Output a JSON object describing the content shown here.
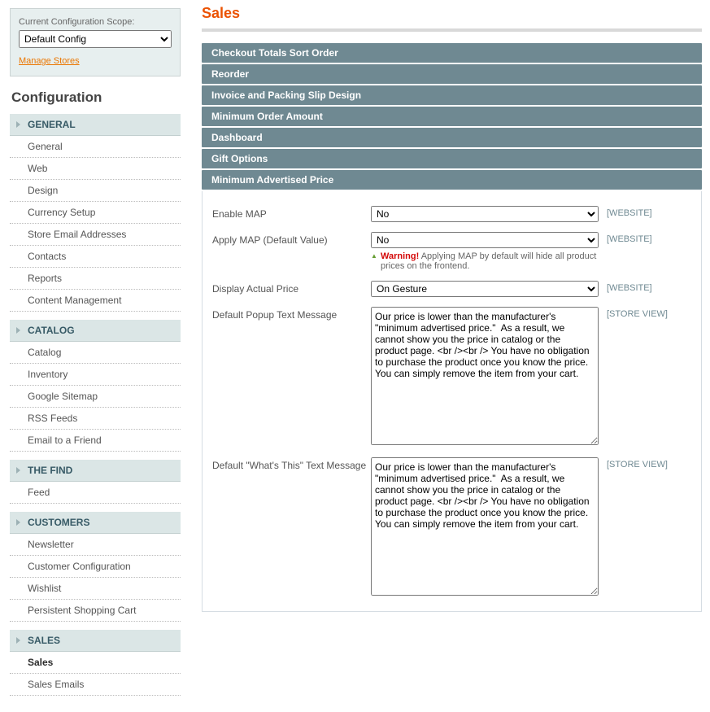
{
  "sidebar": {
    "scope_label": "Current Configuration Scope:",
    "scope_value": "Default Config",
    "manage_stores": "Manage Stores",
    "config_title": "Configuration",
    "groups": [
      {
        "title": "GENERAL",
        "items": [
          "General",
          "Web",
          "Design",
          "Currency Setup",
          "Store Email Addresses",
          "Contacts",
          "Reports",
          "Content Management"
        ]
      },
      {
        "title": "CATALOG",
        "items": [
          "Catalog",
          "Inventory",
          "Google Sitemap",
          "RSS Feeds",
          "Email to a Friend"
        ]
      },
      {
        "title": "THE FIND",
        "items": [
          "Feed"
        ]
      },
      {
        "title": "CUSTOMERS",
        "items": [
          "Newsletter",
          "Customer Configuration",
          "Wishlist",
          "Persistent Shopping Cart"
        ]
      },
      {
        "title": "SALES",
        "items": [
          "Sales",
          "Sales Emails"
        ],
        "active_index": 0
      }
    ]
  },
  "main": {
    "title": "Sales",
    "sections": [
      "Checkout Totals Sort Order",
      "Reorder",
      "Invoice and Packing Slip Design",
      "Minimum Order Amount",
      "Dashboard",
      "Gift Options",
      "Minimum Advertised Price"
    ],
    "fields": {
      "enable_map": {
        "label": "Enable MAP",
        "value": "No",
        "scope": "[WEBSITE]"
      },
      "apply_map": {
        "label": "Apply MAP (Default Value)",
        "value": "No",
        "scope": "[WEBSITE]",
        "note_prefix": "Warning!",
        "note_body": " Applying MAP by default will hide all product prices on the frontend."
      },
      "display_actual": {
        "label": "Display Actual Price",
        "value": "On Gesture",
        "scope": "[WEBSITE]"
      },
      "popup_msg": {
        "label": "Default Popup Text Message",
        "scope": "[STORE VIEW]",
        "value": "Our price is lower than the manufacturer's \"minimum advertised price.\"  As a result, we cannot show you the price in catalog or the product page. <br /><br /> You have no obligation to purchase the product once you know the price. You can simply remove the item from your cart."
      },
      "whats_this_msg": {
        "label": "Default \"What's This\" Text Message",
        "scope": "[STORE VIEW]",
        "value": "Our price is lower than the manufacturer's \"minimum advertised price.\"  As a result, we cannot show you the price in catalog or the product page. <br /><br /> You have no obligation to purchase the product once you know the price. You can simply remove the item from your cart."
      }
    }
  }
}
